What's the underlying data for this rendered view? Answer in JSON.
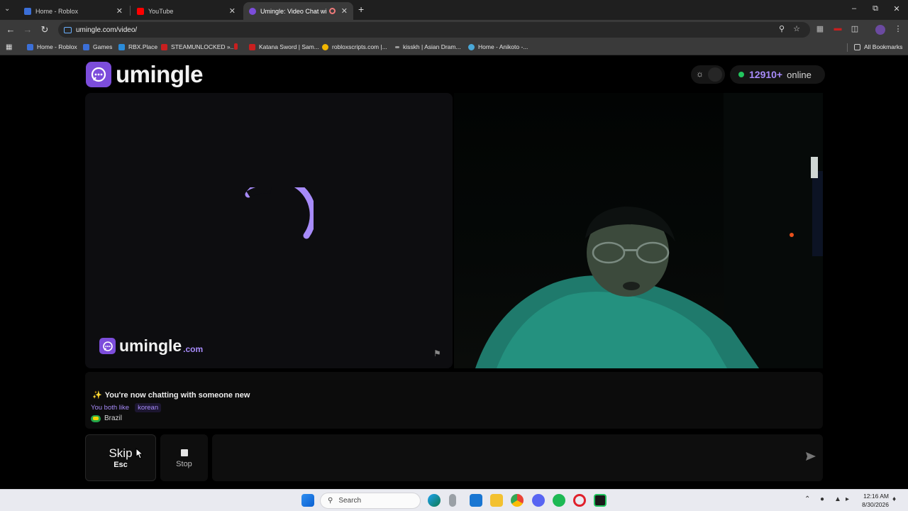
{
  "browser": {
    "tabs": [
      {
        "title": "Home - Roblox",
        "active": false,
        "favicon_color": "#3b6fd8"
      },
      {
        "title": "YouTube",
        "active": false,
        "favicon_color": "#ff0000"
      },
      {
        "title": "Umingle: Video Chat with S",
        "active": true,
        "favicon_color": "#7c4ddb"
      }
    ],
    "url": "umingle.com/video/",
    "bookmarks": [
      {
        "label": "Home - Roblox",
        "icon_color": "#3b6fd8"
      },
      {
        "label": "Games",
        "icon_color": "#3b6fd8"
      },
      {
        "label": "RBX.Place",
        "icon_color": "#2a8bd9"
      },
      {
        "label": "STEAMUNLOCKED »...",
        "icon_color": "#c81f1f"
      },
      {
        "label": "",
        "icon_color": "#c81f1f"
      },
      {
        "label": "Katana Sword | Sam...",
        "icon_color": "#c81f1f"
      },
      {
        "label": "robloxscripts.com |...",
        "icon_color": "#f2b600"
      },
      {
        "label": "kisskh | Asian Dram...",
        "icon_color": "#9a9a9a"
      },
      {
        "label": "Home - Anikoto -...",
        "icon_color": "#4aa8d8"
      }
    ],
    "all_bookmarks": "All Bookmarks"
  },
  "site": {
    "brand": "umingle",
    "online_count": "12910+",
    "online_label": "online",
    "watermark_brand": "umingle",
    "watermark_domain": ".com",
    "accent_color": "#7c4ddb"
  },
  "chat": {
    "sparkle": "✨",
    "status_message": "You're now chatting with someone new",
    "likes_prefix": "You both like",
    "shared_interest": "korean",
    "country": "Brazil"
  },
  "controls": {
    "skip_label": "Skip",
    "skip_shortcut": "Esc",
    "stop_label": "Stop",
    "message_placeholder": ""
  },
  "taskbar": {
    "search_placeholder": "Search",
    "time": "12:16 AM",
    "date": "8/30/2026"
  }
}
